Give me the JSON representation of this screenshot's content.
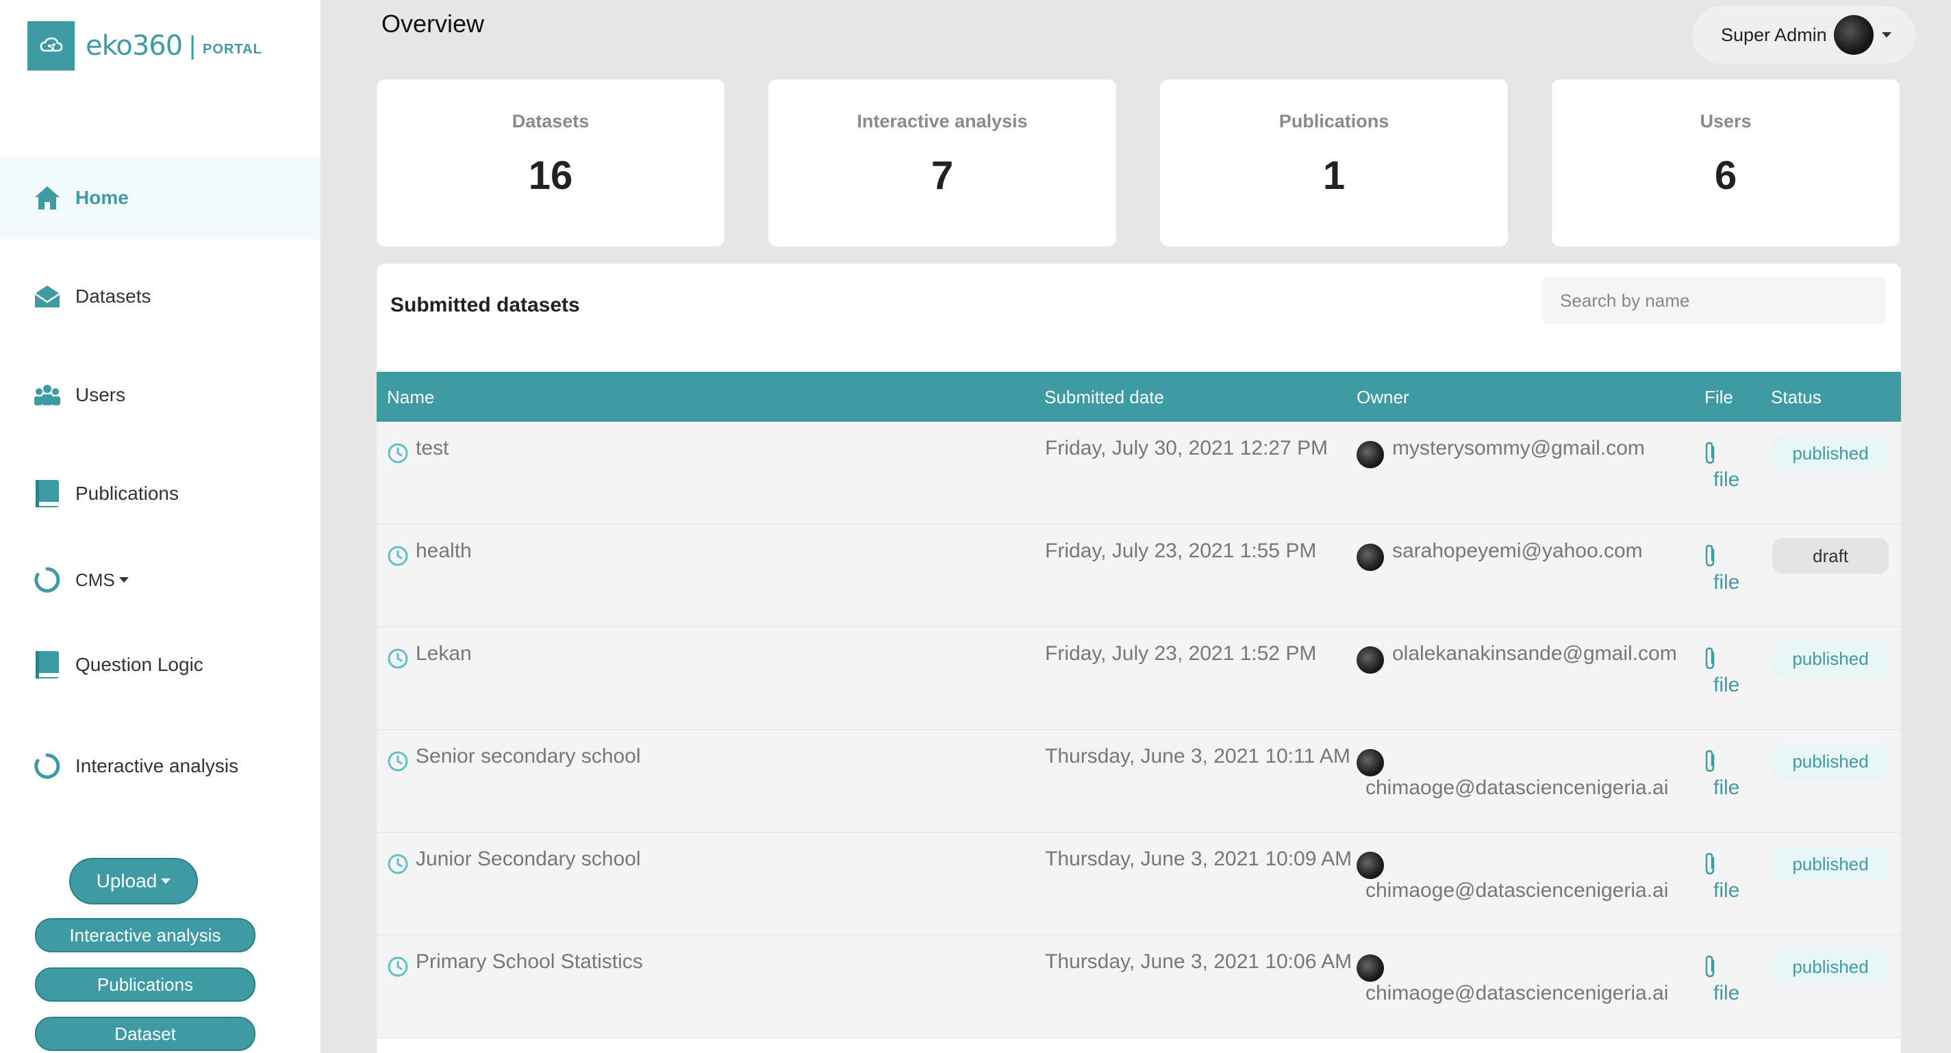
{
  "app": {
    "logo_text": "eko360",
    "logo_sep": "|",
    "logo_portal": "PORTAL"
  },
  "sidebar": {
    "items": [
      {
        "label": "Home",
        "icon": "home-icon",
        "active": true
      },
      {
        "label": "Datasets",
        "icon": "envelope-open-icon"
      },
      {
        "label": "Users",
        "icon": "users-icon"
      },
      {
        "label": "Publications",
        "icon": "book-icon"
      },
      {
        "label": "CMS",
        "icon": "circle-notch-icon",
        "dropdown": true
      },
      {
        "label": "Question Logic",
        "icon": "book-icon"
      },
      {
        "label": "Interactive analysis",
        "icon": "circle-notch-icon"
      }
    ],
    "upload_label": "Upload",
    "quick_buttons": [
      "Interactive analysis",
      "Publications",
      "Dataset"
    ]
  },
  "header": {
    "title": "Overview",
    "user_name": "Super Admin"
  },
  "stats": [
    {
      "title": "Datasets",
      "value": "16"
    },
    {
      "title": "Interactive analysis",
      "value": "7"
    },
    {
      "title": "Publications",
      "value": "1"
    },
    {
      "title": "Users",
      "value": "6"
    }
  ],
  "submitted": {
    "title": "Submitted datasets",
    "search_placeholder": "Search by name",
    "columns": [
      "Name",
      "Submitted date",
      "Owner",
      "File",
      "Status"
    ],
    "file_label": "file",
    "rows": [
      {
        "name": "test",
        "date": "Friday, July 30, 2021 12:27 PM",
        "owner": "mysterysommy@gmail.com",
        "status": "published"
      },
      {
        "name": "health",
        "date": "Friday, July 23, 2021 1:55 PM",
        "owner": "sarahopeyemi@yahoo.com",
        "status": "draft"
      },
      {
        "name": "Lekan",
        "date": "Friday, July 23, 2021 1:52 PM",
        "owner": "olalekanakinsande@gmail.com",
        "status": "published"
      },
      {
        "name": "Senior secondary school",
        "date": "Thursday, June 3, 2021 10:11 AM",
        "owner": "chimaoge@datasciencenigeria.ai",
        "status": "published"
      },
      {
        "name": "Junior Secondary school",
        "date": "Thursday, June 3, 2021 10:09 AM",
        "owner": "chimaoge@datasciencenigeria.ai",
        "status": "published"
      },
      {
        "name": "Primary School Statistics",
        "date": "Thursday, June 3, 2021 10:06 AM",
        "owner": "chimaoge@datasciencenigeria.ai",
        "status": "published"
      }
    ]
  },
  "colors": {
    "accent": "#3f9ba3",
    "background": "#e6e6e6"
  }
}
